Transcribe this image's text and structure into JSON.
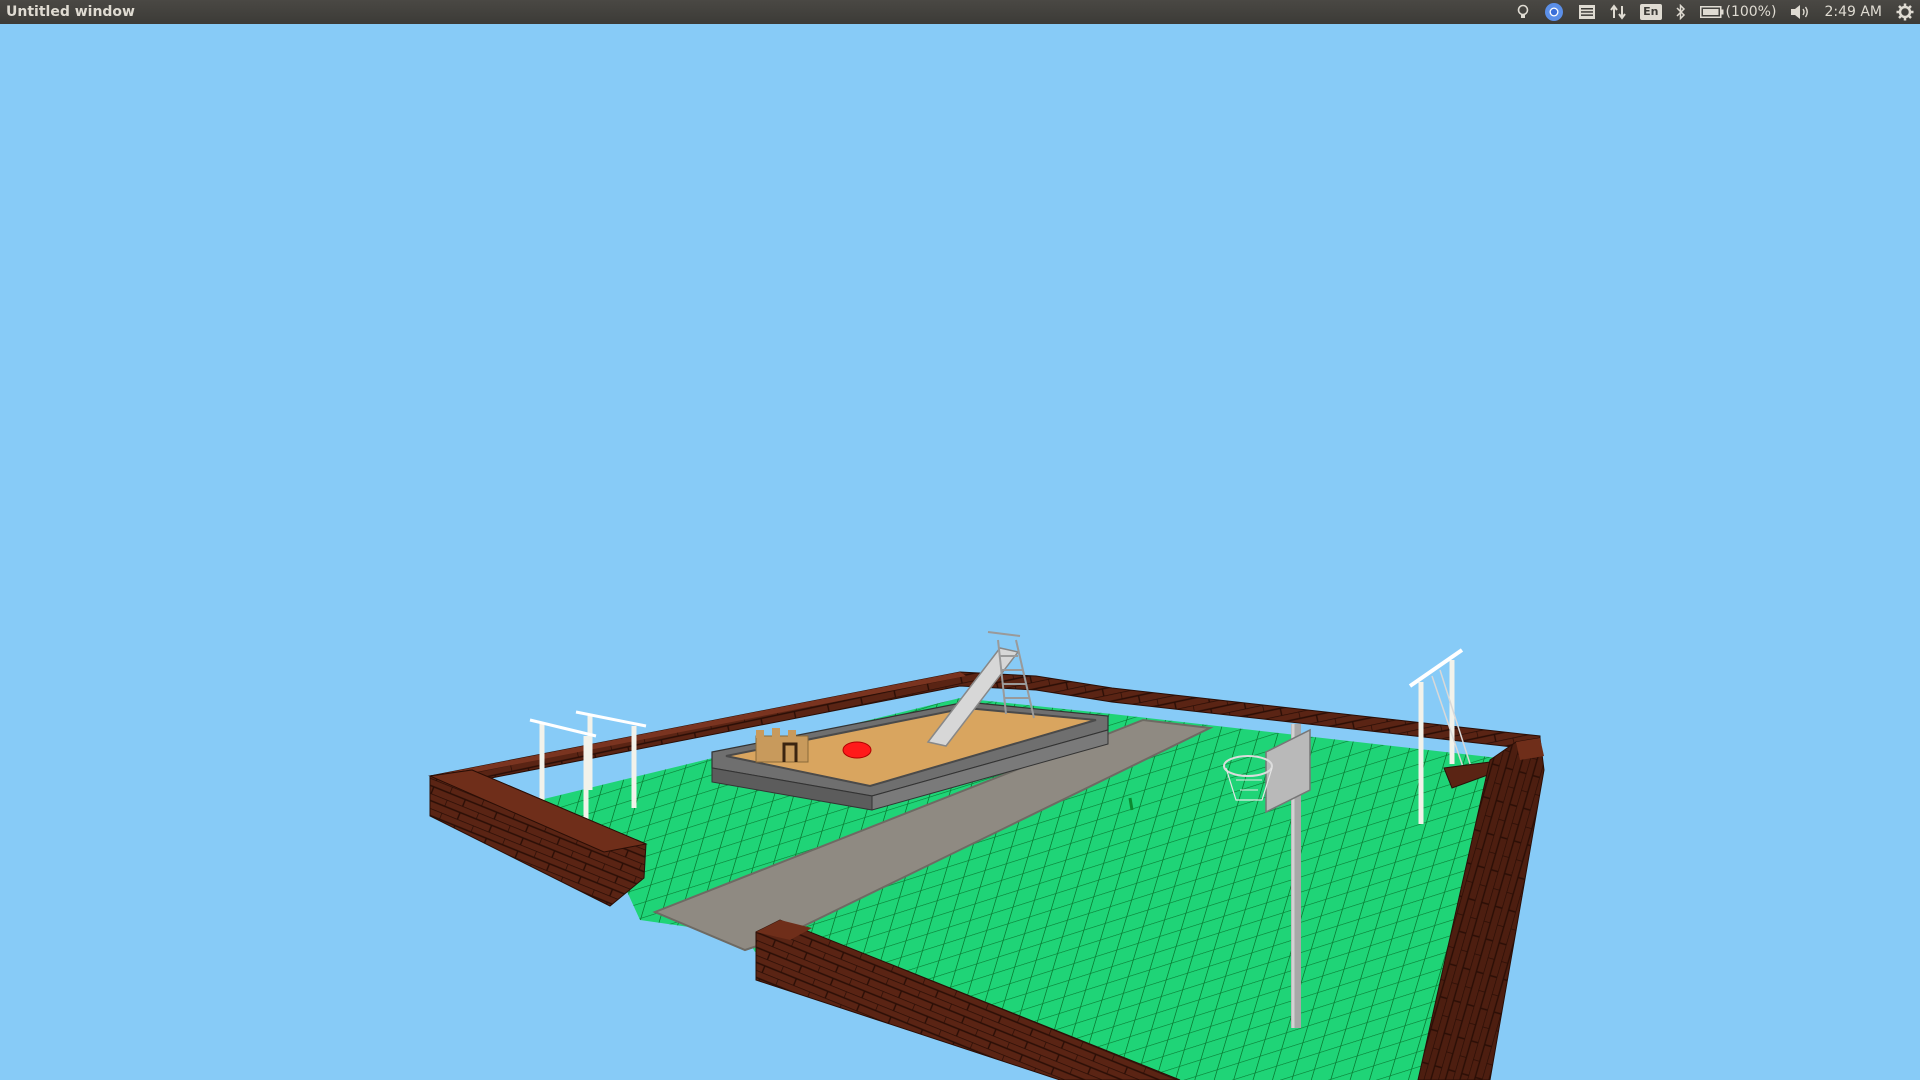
{
  "window": {
    "title": "Untitled window"
  },
  "panel": {
    "keyboard_layout": "En",
    "battery_text": "(100%)",
    "clock": "2:49 AM",
    "icons": [
      "lightbulb-icon",
      "chrome-icon",
      "list-icon",
      "network-arrows-icon",
      "keyboard-layout-icon",
      "bluetooth-icon",
      "battery-icon",
      "volume-icon",
      "gear-icon"
    ]
  },
  "scene": {
    "description_colors": {
      "sky": "#87CBF7",
      "grass": "#1fd477",
      "grid_line": "#0a9a3a",
      "brick": "#5a2414",
      "path": "#8f8a82",
      "sand": "#d9a55f",
      "sandbox_border": "#7a7a7a",
      "ball": "#ff1a1a",
      "pole": "#bfbfbf"
    }
  }
}
